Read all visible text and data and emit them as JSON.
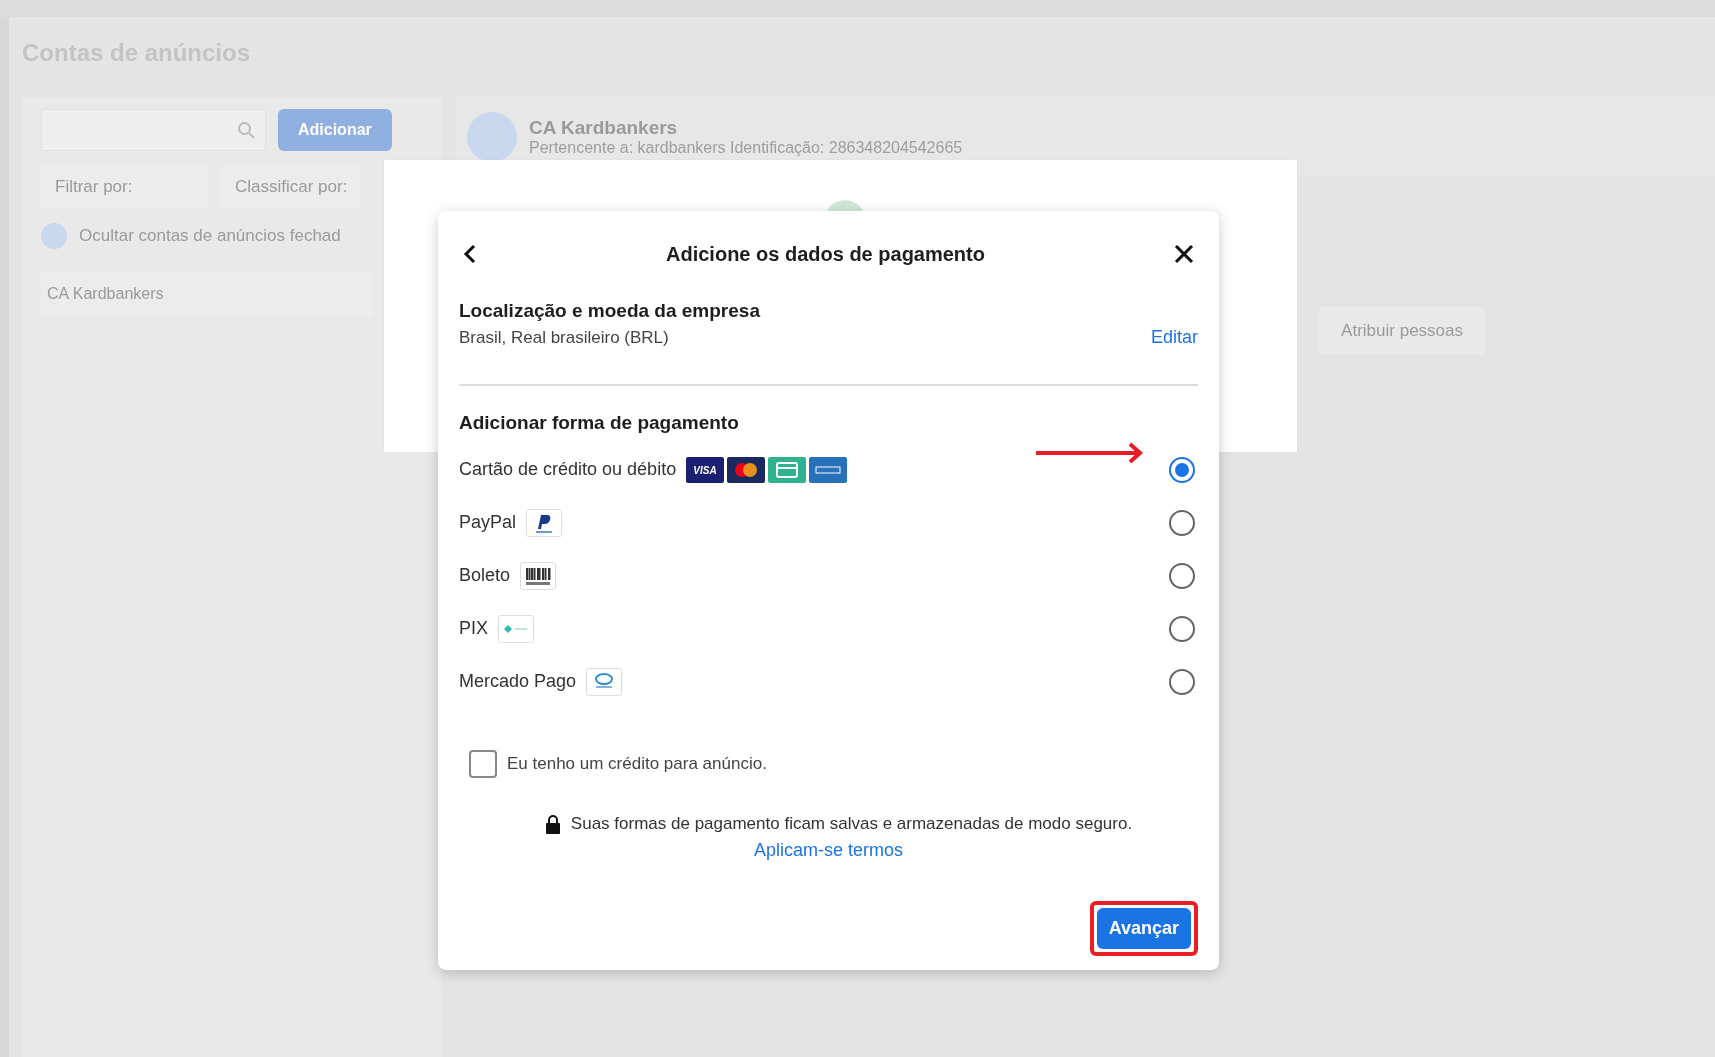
{
  "page": {
    "title": "Contas de anúncios"
  },
  "sidebar": {
    "add_button": "Adicionar",
    "filter": "Filtrar por:",
    "sort": "Classificar por:",
    "hide_closed": "Ocultar contas de anúncios fechad",
    "accounts": [
      "CA Kardbankers"
    ]
  },
  "account_header": {
    "name": "CA Kardbankers",
    "subtitle": "Pertencente a: kardbankers  Identificação: 286348204542665"
  },
  "people_button": "Atribuir pessoas",
  "modal": {
    "title": "Adicione os dados de pagamento",
    "business": {
      "heading": "Localização e moeda da empresa",
      "value": "Brasil, Real brasileiro (BRL)",
      "edit": "Editar"
    },
    "payment": {
      "heading": "Adicionar forma de pagamento",
      "methods": [
        {
          "label": "Cartão de crédito ou débito",
          "kind": "card",
          "selected": true,
          "badges": [
            {
              "kind": "visa",
              "text": "VISA"
            },
            {
              "kind": "mastercard"
            },
            {
              "kind": "generic"
            },
            {
              "kind": "amex"
            }
          ]
        },
        {
          "label": "PayPal",
          "kind": "paypal",
          "selected": false
        },
        {
          "label": "Boleto",
          "kind": "boleto",
          "selected": false
        },
        {
          "label": "PIX",
          "kind": "pix",
          "selected": false
        },
        {
          "label": "Mercado Pago",
          "kind": "wallet",
          "selected": false
        }
      ]
    },
    "credit": {
      "label": "Eu tenho um crédito para anúncio.",
      "checked": false
    },
    "security_note": "Suas formas de pagamento ficam salvas e armazenadas de modo seguro.",
    "terms_link": "Aplicam-se termos",
    "next_button": "Avançar"
  }
}
